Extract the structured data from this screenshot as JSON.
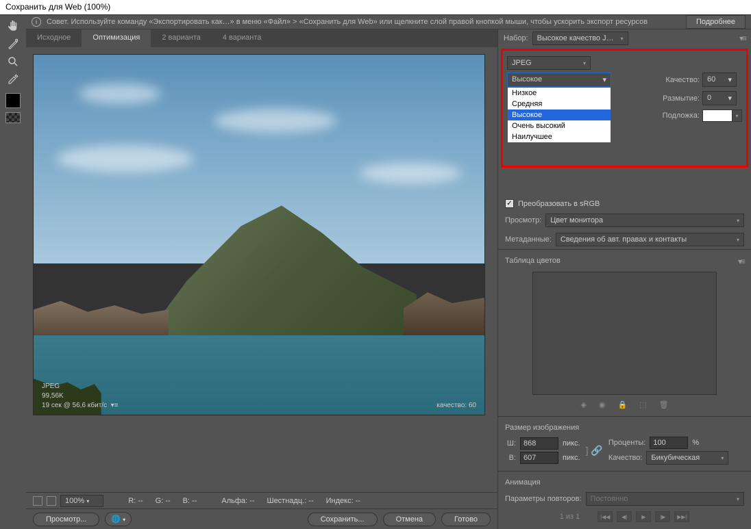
{
  "title": "Сохранить для Web (100%)",
  "tip": {
    "text": "Совет. Используйте команду «Экспортировать как…» в меню «Файл» > «Сохранить для Web» или щелкните слой правой кнопкой мыши, чтобы ускорить экспорт ресурсов",
    "more": "Подробнее"
  },
  "tabs": [
    "Исходное",
    "Оптимизация",
    "2 варианта",
    "4 варианта"
  ],
  "active_tab": 1,
  "preview_info": {
    "format": "JPEG",
    "size": "99,56K",
    "time": "19 сек @ 56,6 кбит/с",
    "quality_label": "качество: 60"
  },
  "status": {
    "zoom": "100%",
    "r": "R: --",
    "g": "G: --",
    "b": "B: --",
    "alpha": "Альфа: --",
    "hex": "Шестнадц.: --",
    "index": "Индекс: --"
  },
  "preset": {
    "label": "Набор:",
    "value": "Высокое качество J…"
  },
  "format_select": "JPEG",
  "quality_dropdown": {
    "selected": "Высокое",
    "options": [
      "Низкое",
      "Средняя",
      "Высокое",
      "Очень высокий",
      "Наилучшее"
    ]
  },
  "opts": {
    "quality_label": "Качество:",
    "quality_value": "60",
    "blur_label": "Размытие:",
    "blur_value": "0",
    "matte_label": "Подложка:"
  },
  "srgb": {
    "label": "Преобразовать в sRGB",
    "checked": true
  },
  "preview_row": {
    "label": "Просмотр:",
    "value": "Цвет монитора"
  },
  "metadata_row": {
    "label": "Метаданные:",
    "value": "Сведения об авт. правах и контакты"
  },
  "color_table_title": "Таблица цветов",
  "image_size": {
    "title": "Размер изображения",
    "w_label": "Ш:",
    "w_value": "868",
    "h_label": "В:",
    "h_value": "607",
    "px": "пикс.",
    "percent_label": "Проценты:",
    "percent_value": "100",
    "percent_suffix": "%",
    "quality_label": "Качество:",
    "quality_value": "Бикубическая"
  },
  "animation": {
    "title": "Анимация",
    "loop_label": "Параметры повторов:",
    "loop_value": "Постоянно",
    "frame": "1 из 1"
  },
  "footer": {
    "preview": "Просмотр...",
    "save": "Сохранить...",
    "cancel": "Отмена",
    "done": "Готово"
  }
}
